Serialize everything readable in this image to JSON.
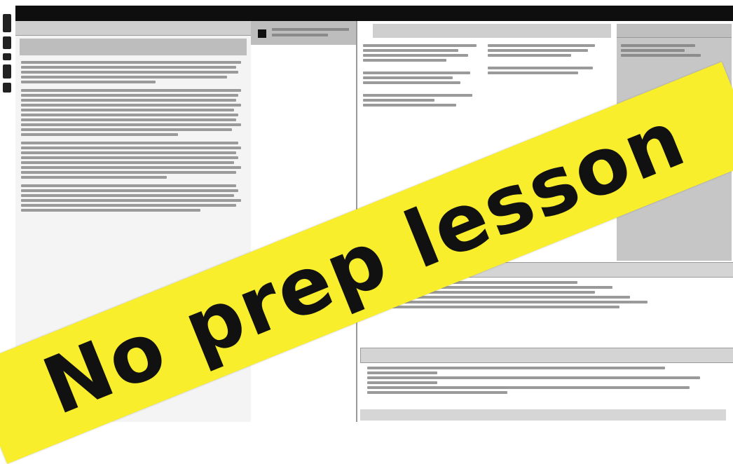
{
  "banner": {
    "text": "No prep lesson"
  },
  "colors": {
    "banner": "#f8ee2c",
    "banner_text": "#111111",
    "topbar": "#0e0e0e"
  }
}
